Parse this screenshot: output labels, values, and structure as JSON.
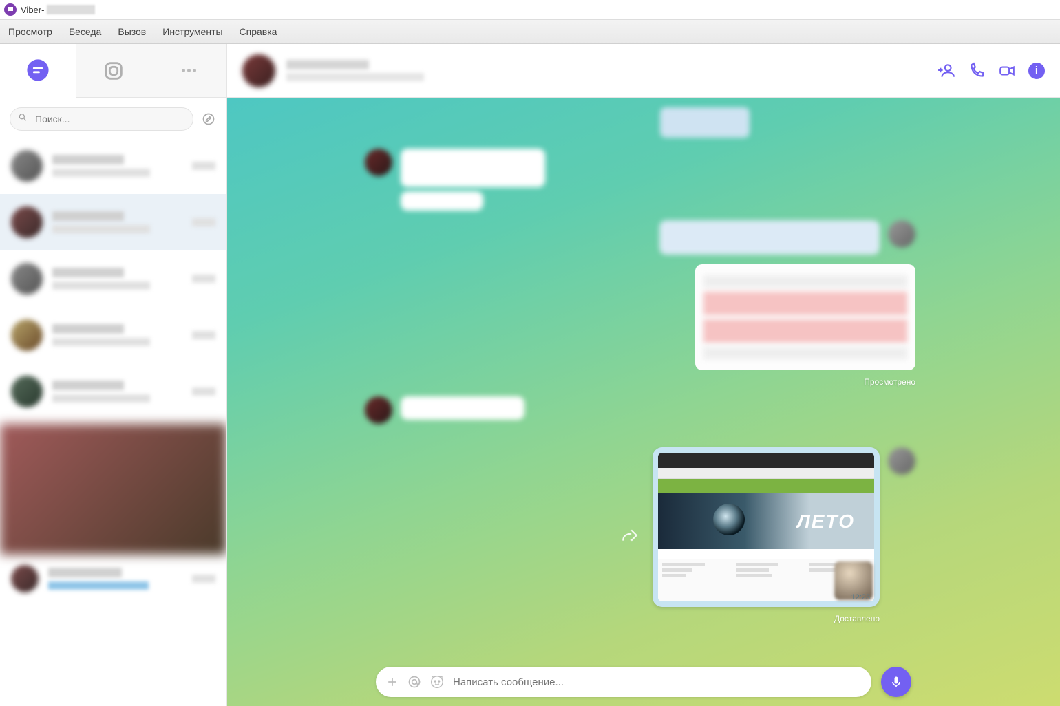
{
  "window": {
    "app": "Viber",
    "title_suffix_redacted": true
  },
  "menubar": [
    "Просмотр",
    "Беседа",
    "Вызов",
    "Инструменты",
    "Справка"
  ],
  "sidebar": {
    "search_placeholder": "Поиск...",
    "tabs": {
      "chats_active": true
    }
  },
  "chat": {
    "header": {
      "actions": {
        "add_contact": "add-contact",
        "voice_call": "voice-call",
        "video_call": "video-call",
        "info": "i"
      }
    },
    "statuses": {
      "seen": "Просмотрено",
      "delivered": "Доставлено"
    },
    "attachment": {
      "hero_text": "ЛЕТО",
      "timestamp": "12:23"
    },
    "composer": {
      "placeholder": "Написать сообщение..."
    }
  }
}
